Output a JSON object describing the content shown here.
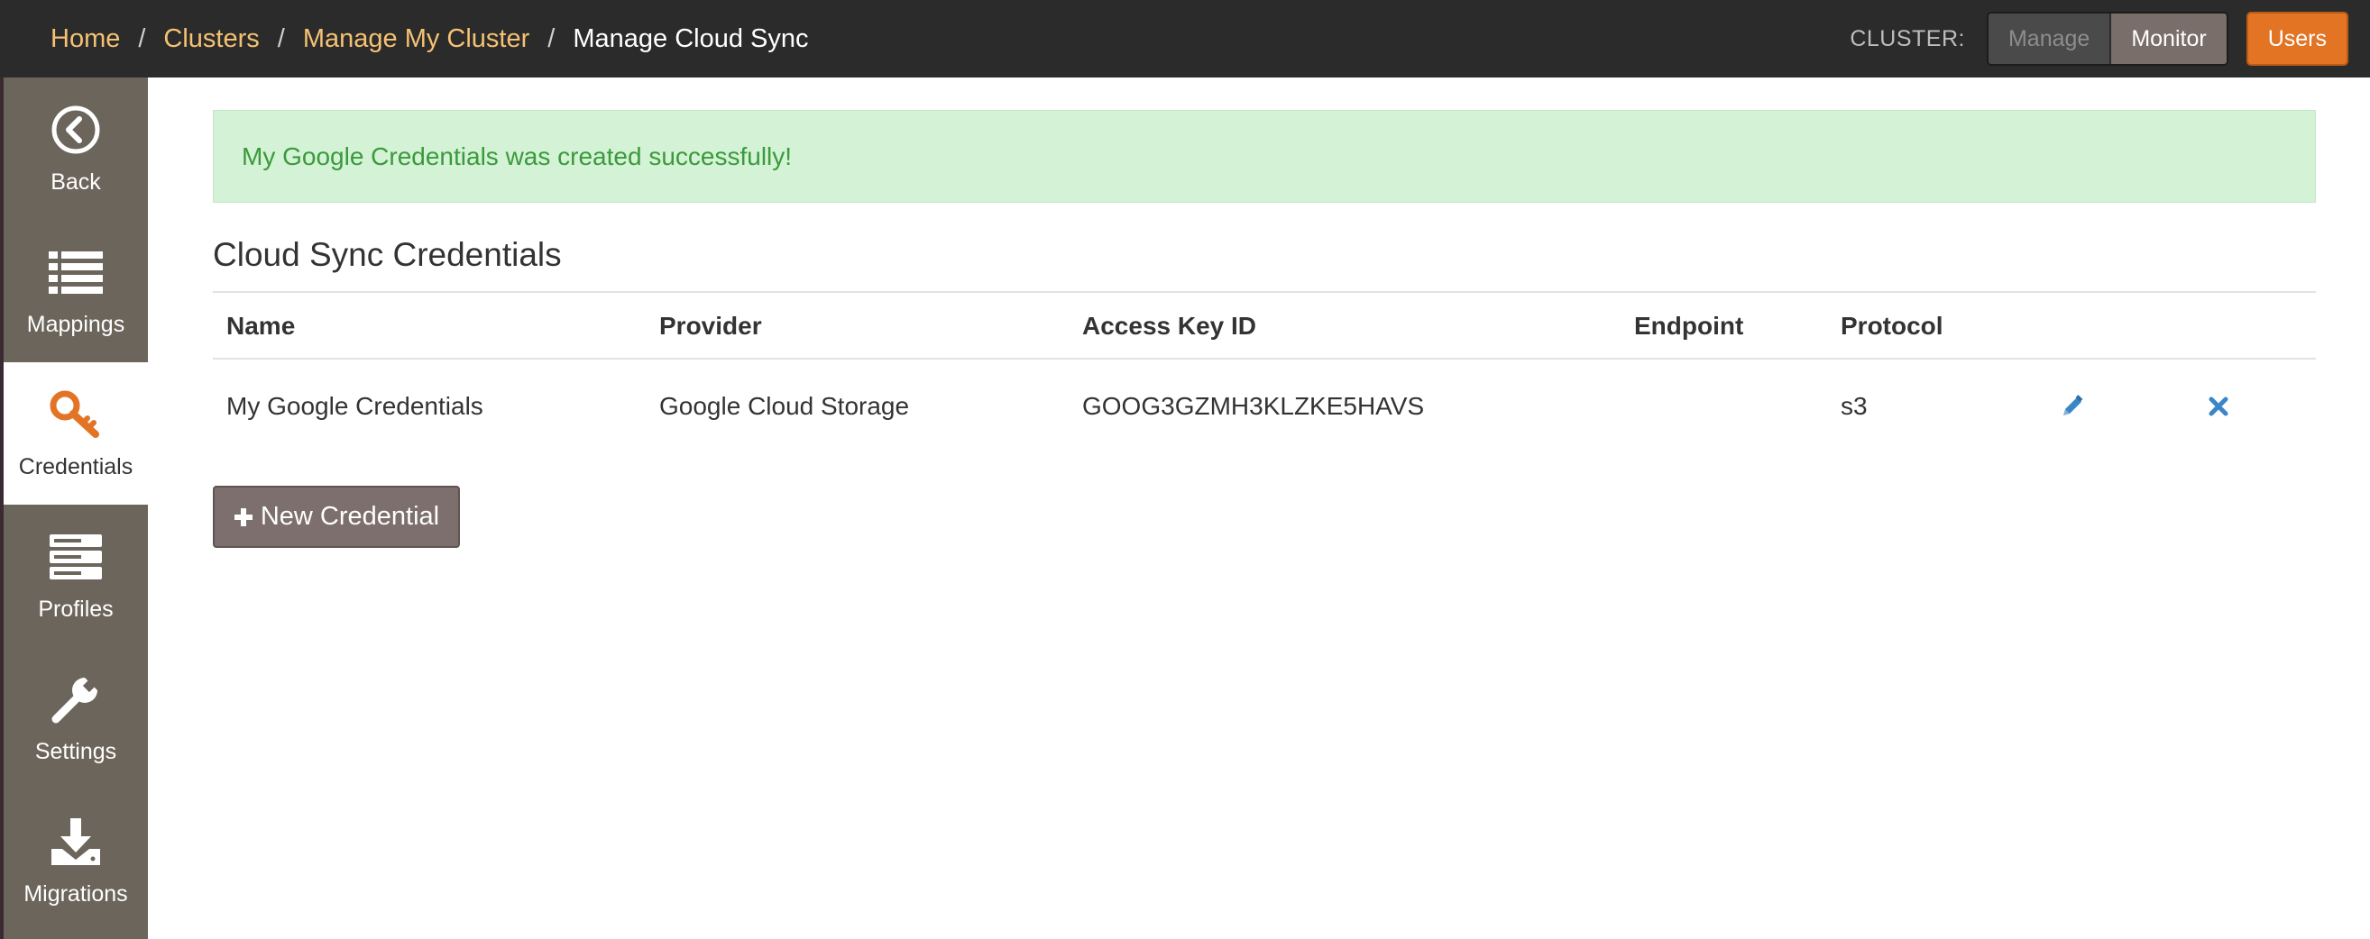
{
  "breadcrumb": {
    "home": "Home",
    "clusters": "Clusters",
    "manage_cluster": "Manage My Cluster",
    "current": "Manage Cloud Sync",
    "separator": "/"
  },
  "topbar": {
    "cluster_label": "CLUSTER:",
    "manage_label": "Manage",
    "monitor_label": "Monitor",
    "users_label": "Users"
  },
  "sidebar": {
    "items": [
      {
        "label": "Back",
        "icon": "back-circle-icon"
      },
      {
        "label": "Mappings",
        "icon": "list-icon"
      },
      {
        "label": "Credentials",
        "icon": "key-icon",
        "active": true
      },
      {
        "label": "Profiles",
        "icon": "server-stack-icon"
      },
      {
        "label": "Settings",
        "icon": "wrench-icon"
      },
      {
        "label": "Migrations",
        "icon": "download-icon"
      }
    ]
  },
  "alert": {
    "message": "My Google Credentials was created successfully!"
  },
  "section": {
    "title": "Cloud Sync Credentials"
  },
  "table": {
    "headers": {
      "name": "Name",
      "provider": "Provider",
      "access_key_id": "Access Key ID",
      "endpoint": "Endpoint",
      "protocol": "Protocol"
    },
    "rows": [
      {
        "name": "My Google Credentials",
        "provider": "Google Cloud Storage",
        "access_key_id": "GOOG3GZMH3KLZKE5HAVS",
        "endpoint": "",
        "protocol": "s3"
      }
    ]
  },
  "actions": {
    "new_credential_label": "New Credential"
  },
  "colors": {
    "topbar_bg": "#2b2b2b",
    "breadcrumb_link": "#f5c273",
    "sidebar_bg": "#6c655b",
    "accent_orange": "#e27424",
    "alert_bg": "#d4f2d5",
    "alert_text": "#3a9a3c",
    "action_icon_blue": "#3a86c8",
    "new_button_bg": "#7d6f6d"
  }
}
